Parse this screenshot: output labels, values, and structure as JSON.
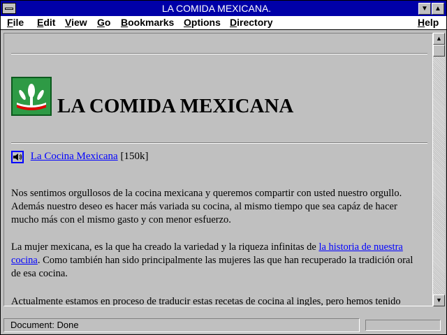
{
  "window": {
    "title": "LA COMIDA MEXICANA."
  },
  "menu": [
    "File",
    "Edit",
    "View",
    "Go",
    "Bookmarks",
    "Options",
    "Directory",
    "Help"
  ],
  "page": {
    "heading": "LA COMIDA MEXICANA",
    "audio_link": "La Cocina Mexicana",
    "audio_size": "[150k]",
    "p1": "Nos sentimos orgullosos de la cocina mexicana y queremos compartir con usted nuestro orgullo. Además nuestro deseo es hacer más variada su cocina, al mismo tiempo que sea capáz de hacer mucho más con el mismo gasto y con menor esfuerzo.",
    "p2_before": "La mujer mexicana, es la que ha creado la variedad y la riqueza infinitas de ",
    "p2_link": "la historia de nuestra cocina",
    "p2_after": ". Como también han sido principalmente las mujeres las que han recuperado la tradición oral de esa cocina.",
    "p3": "Actualmente estamos en proceso de traducir estas recetas de cocina al ingles, pero hemos tenido"
  },
  "status": {
    "text": "Document: Done"
  },
  "colors": {
    "titlebar": "#0000a8",
    "link": "#0000ff",
    "background": "#c0c0c0"
  }
}
